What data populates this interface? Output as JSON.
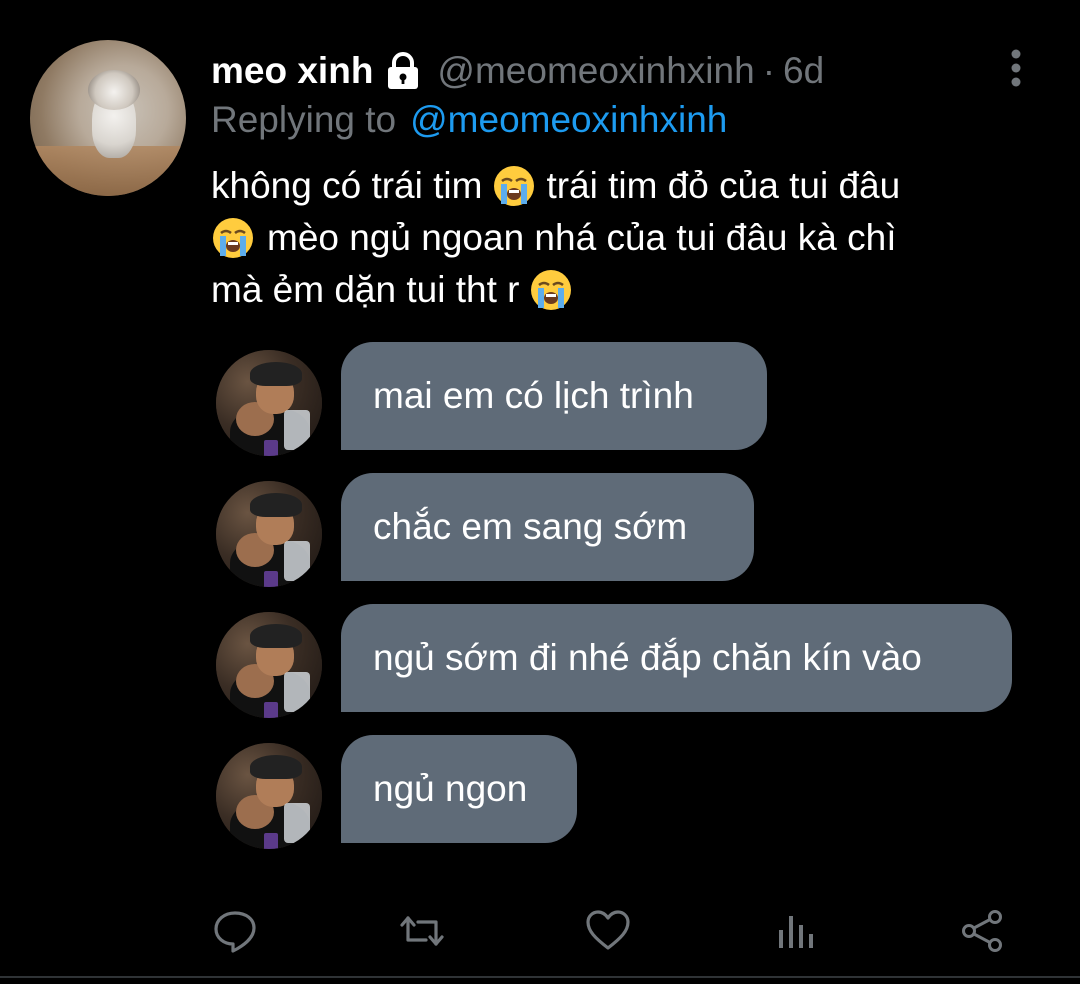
{
  "tweet": {
    "author": {
      "display_name": "meo xinh",
      "handle": "@meomeoxinhxinh",
      "protected": true
    },
    "separator": "·",
    "age": "6d",
    "replying_to": {
      "label": "Replying to",
      "handle": "@meomeoxinhxinh"
    },
    "text_lines": [
      [
        "không có trái tim",
        "trái tim đỏ của tui đâu"
      ],
      [
        "mèo ngủ ngoan nhá của tui đâu kà chì"
      ],
      [
        "mà ẻm dặn tui tht r"
      ]
    ],
    "emoji": "loudly-crying-face"
  },
  "chat_image": {
    "bubble_color": "#5f6b78",
    "messages": [
      "mai em có lịch trình",
      "chắc em sang sớm",
      "ngủ sớm đi nhé đắp chăn kín vào",
      "ngủ ngon"
    ]
  },
  "actions": [
    "reply-icon",
    "retweet-icon",
    "like-icon",
    "analytics-icon",
    "share-icon"
  ],
  "colors": {
    "background": "#000000",
    "text": "#ffffff",
    "muted": "#71767b",
    "link": "#1d9bf0"
  }
}
